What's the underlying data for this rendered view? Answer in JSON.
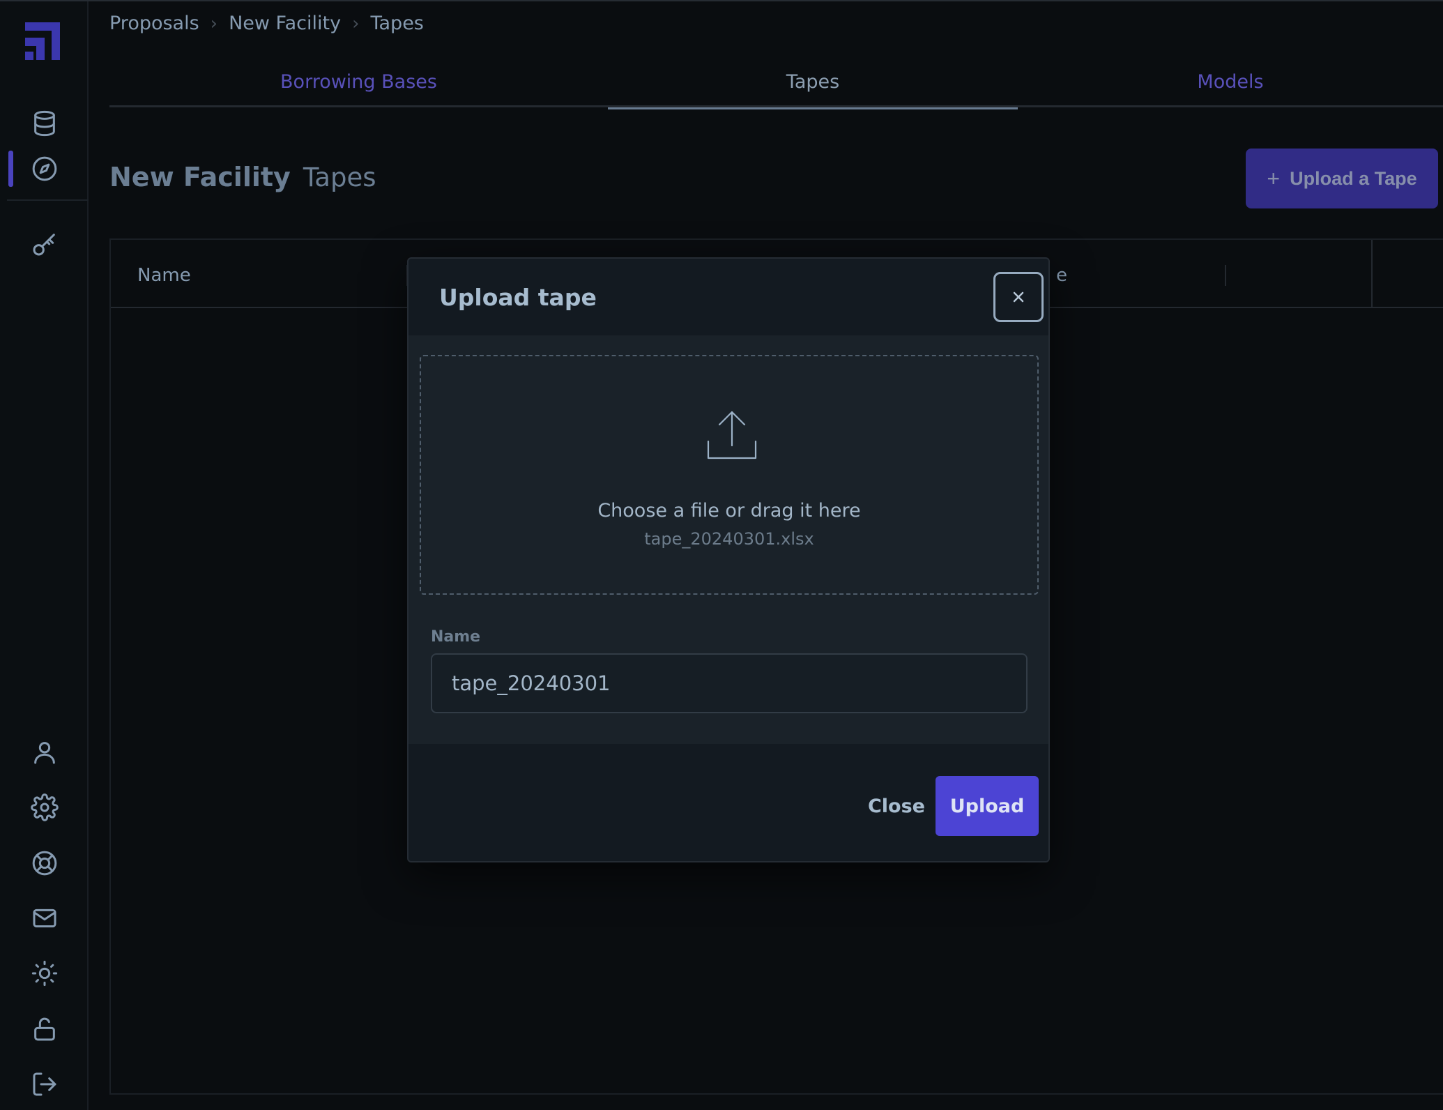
{
  "breadcrumb": [
    "Proposals",
    "New Facility",
    "Tapes"
  ],
  "tabs": [
    {
      "label": "Borrowing Bases",
      "active": false
    },
    {
      "label": "Tapes",
      "active": true
    },
    {
      "label": "Models",
      "active": false
    }
  ],
  "page": {
    "title": "New Facility",
    "subtitle": "Tapes",
    "upload_button": "Upload a Tape"
  },
  "table": {
    "headers": [
      "Name",
      "e"
    ]
  },
  "sidebar": {
    "top_icons": [
      "database-icon",
      "compass-icon",
      "key-icon"
    ],
    "bottom_icons": [
      "user-icon",
      "gear-icon",
      "life-buoy-icon",
      "mail-icon",
      "sun-icon",
      "unlock-icon",
      "logout-icon"
    ],
    "active_item": "compass-icon"
  },
  "modal": {
    "title": "Upload tape",
    "dropzone_text": "Choose a file or drag it here",
    "file_name": "tape_20240301.xlsx",
    "name_label": "Name",
    "name_value": "tape_20240301",
    "close_label": "Close",
    "upload_label": "Upload"
  },
  "colors": {
    "accent": "#4c44d4",
    "background": "#0b0e11",
    "modal": "#131a21"
  }
}
